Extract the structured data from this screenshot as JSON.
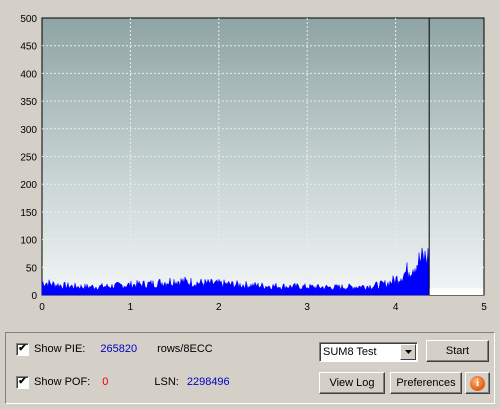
{
  "chart_data": {
    "type": "area",
    "x_ticks": [
      "0",
      "1",
      "2",
      "3",
      "4",
      "5"
    ],
    "y_ticks": [
      "0",
      "50",
      "100",
      "150",
      "200",
      "250",
      "300",
      "350",
      "400",
      "450",
      "500"
    ],
    "xlim": [
      0,
      5
    ],
    "ylim": [
      0,
      500
    ],
    "grid": true,
    "end_marker_x": 4.38,
    "series_color": "#0000ff",
    "series": [
      {
        "x": [
          0,
          0.25,
          0.5,
          0.75,
          1.0,
          1.25,
          1.5,
          1.75,
          2.0,
          2.25,
          2.5,
          2.75,
          3.0,
          3.25,
          3.5,
          3.75,
          3.9,
          4.0,
          4.1,
          4.2,
          4.3,
          4.38
        ],
        "y": [
          25,
          18,
          16,
          17,
          20,
          22,
          28,
          24,
          22,
          20,
          18,
          17,
          16,
          15,
          16,
          18,
          22,
          30,
          42,
          58,
          70,
          75
        ]
      }
    ]
  },
  "controls": {
    "show_pie_label": "Show PIE:",
    "show_pie_checked": "✔",
    "pie_value": "265820",
    "pie_unit": "rows/8ECC",
    "show_pof_label": "Show POF:",
    "show_pof_checked": "✔",
    "pof_value": "0",
    "lsn_label": "LSN:",
    "lsn_value": "2298496",
    "test_select_value": "SUM8 Test",
    "start_label": "Start",
    "view_log_label": "View Log",
    "preferences_label": "Preferences",
    "info_glyph": "i"
  }
}
